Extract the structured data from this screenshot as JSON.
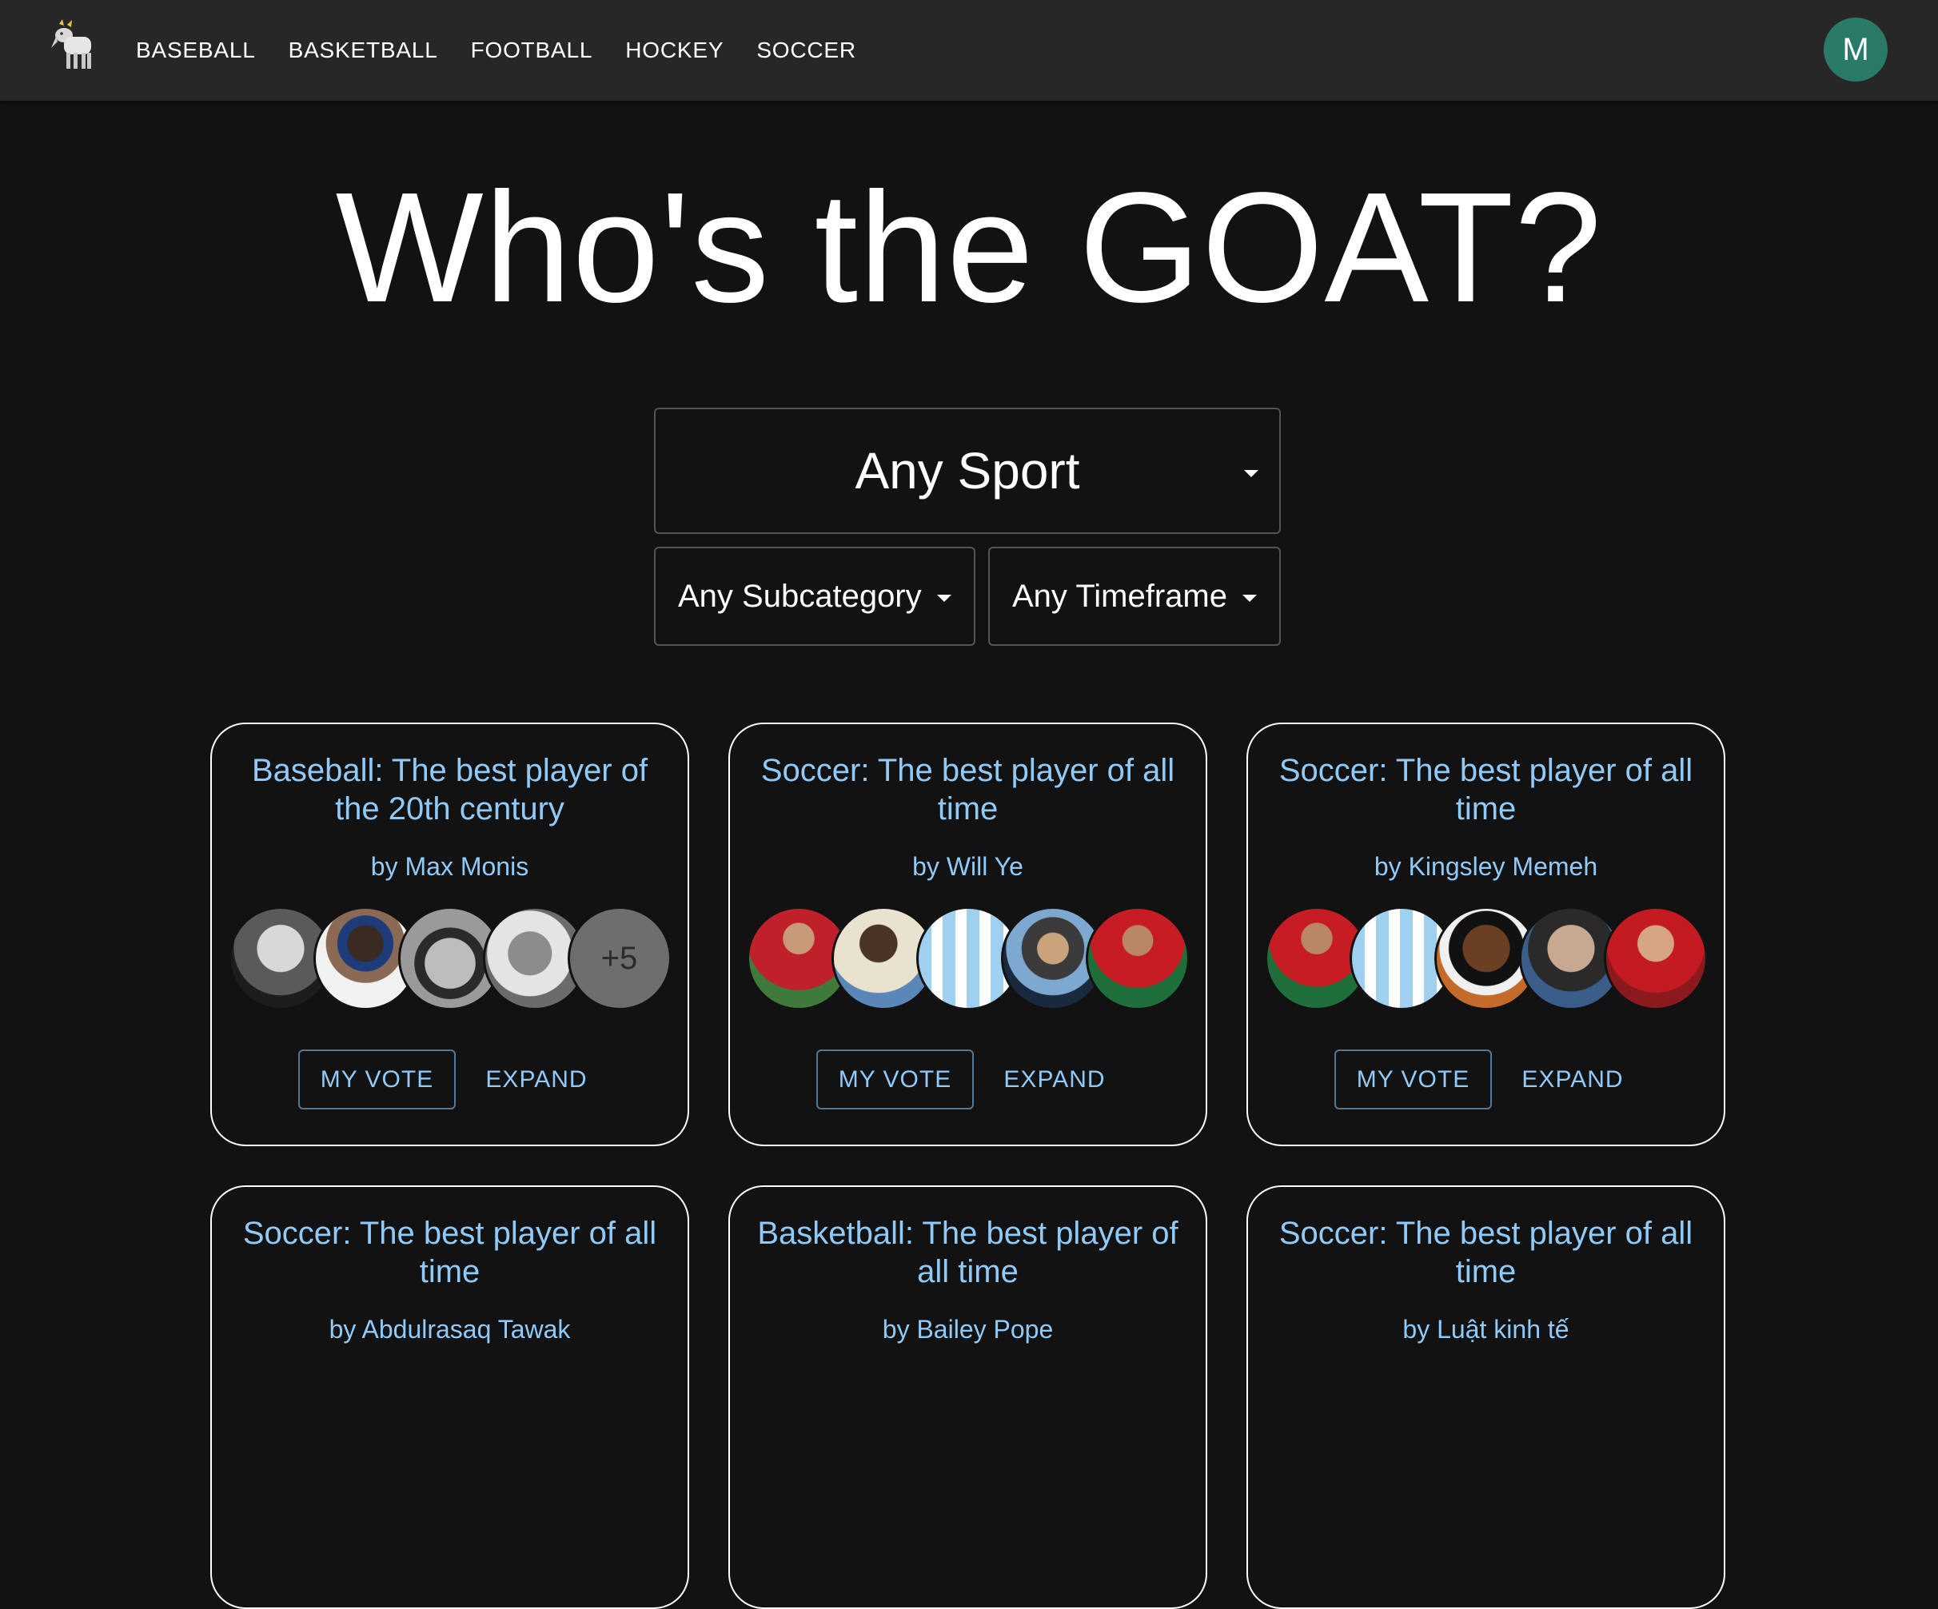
{
  "nav": {
    "items": [
      "BASEBALL",
      "BASKETBALL",
      "FOOTBALL",
      "HOCKEY",
      "SOCCER"
    ],
    "user_initial": "M"
  },
  "hero": {
    "title": "Who's the GOAT?"
  },
  "filters": {
    "sport": "Any Sport",
    "subcategory": "Any Subcategory",
    "timeframe": "Any Timeframe"
  },
  "cards": [
    {
      "title": "Baseball: The best player of the 20th century",
      "author": "by Max Monis",
      "more_count": "+5",
      "vote_label": "MY VOTE",
      "expand_label": "EXPAND"
    },
    {
      "title": "Soccer: The best player of all time",
      "author": "by Will Ye",
      "vote_label": "MY VOTE",
      "expand_label": "EXPAND"
    },
    {
      "title": "Soccer: The best player of all time",
      "author": "by Kingsley Memeh",
      "vote_label": "MY VOTE",
      "expand_label": "EXPAND"
    },
    {
      "title": "Soccer: The best player of all time",
      "author": "by Abdulrasaq Tawak"
    },
    {
      "title": "Basketball: The best player of all time",
      "author": "by Bailey Pope"
    },
    {
      "title": "Soccer: The best player of all time",
      "author": "by Luật kinh tế"
    }
  ],
  "colors": {
    "background": "#121212",
    "appbar": "#272727",
    "accent": "#90caf9",
    "avatar": "#2a7a6a"
  }
}
